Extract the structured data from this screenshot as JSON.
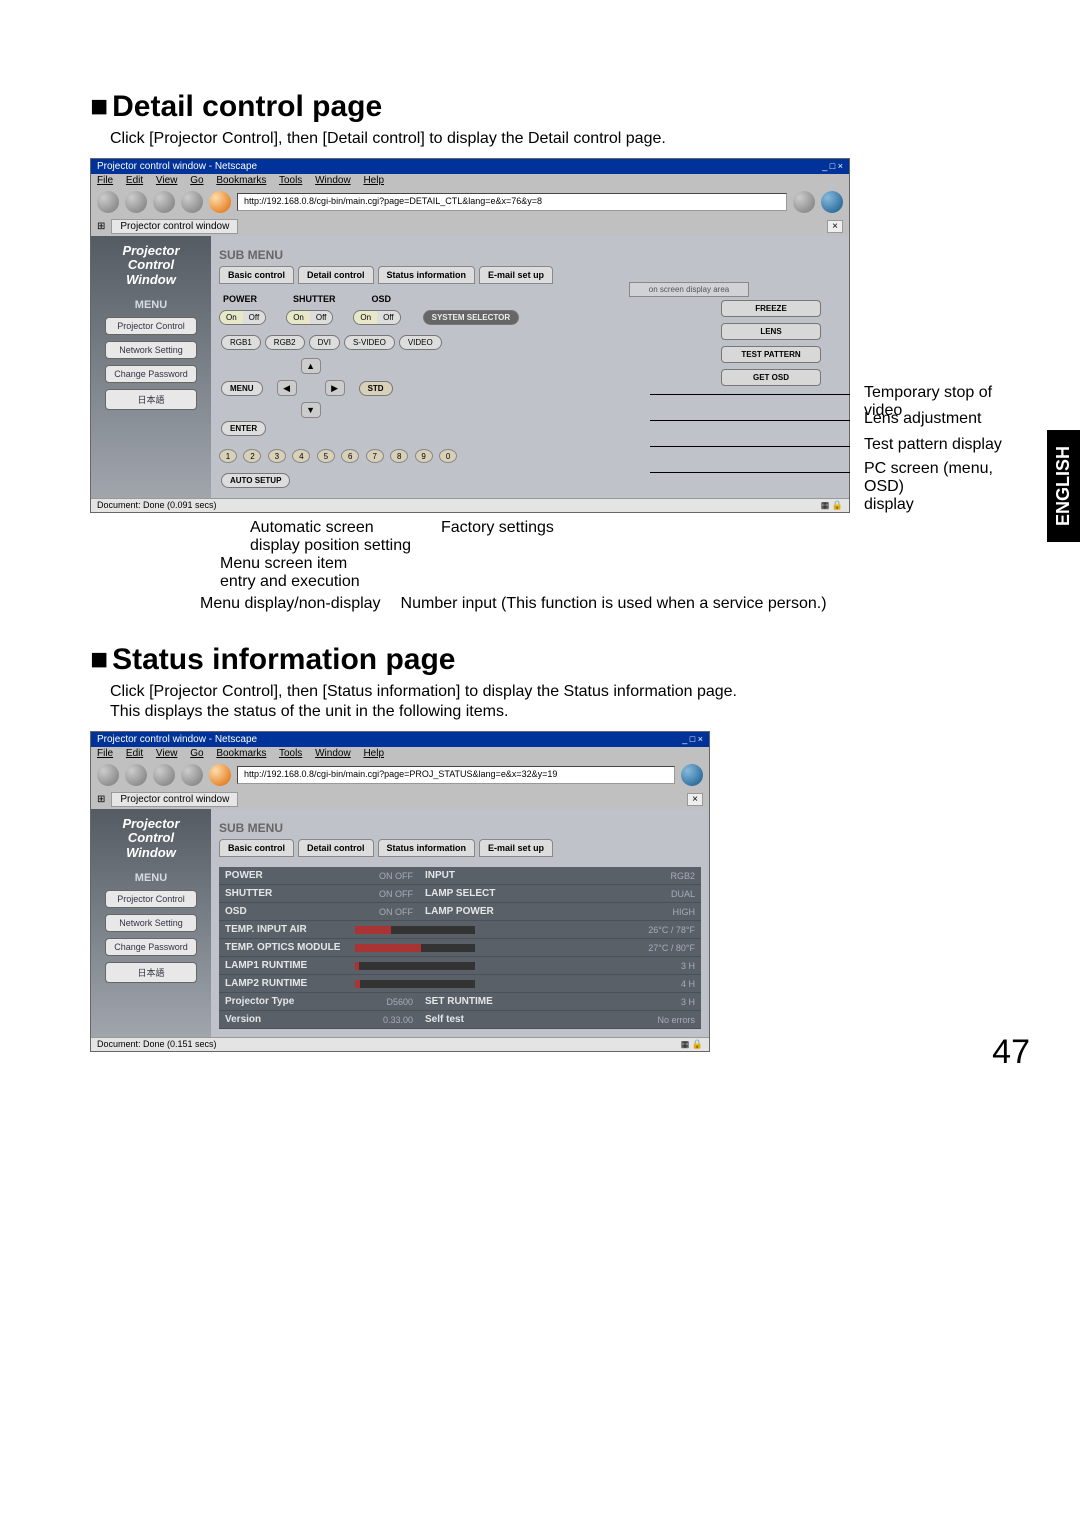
{
  "sideTab": "ENGLISH",
  "pageNumber": "47",
  "section1": {
    "heading": "Detail control page",
    "intro": "Click [Projector Control], then [Detail control] to display the Detail control page."
  },
  "section2": {
    "heading": "Status information page",
    "intro1": "Click [Projector Control], then [Status information] to display the Status information page.",
    "intro2": "This displays the status of the unit in the following items."
  },
  "browser1": {
    "title": "Projector control window - Netscape",
    "winControls": "_ □ ×",
    "menus": {
      "file": "File",
      "edit": "Edit",
      "view": "View",
      "go": "Go",
      "bookmarks": "Bookmarks",
      "tools": "Tools",
      "window": "Window",
      "help": "Help"
    },
    "url": "http://192.168.0.8/cgi-bin/main.cgi?page=DETAIL_CTL&lang=e&x=76&y=8",
    "tab": "Projector control window",
    "status": "Document: Done (0.091 secs)"
  },
  "browser2": {
    "title": "Projector control window - Netscape",
    "url": "http://192.168.0.8/cgi-bin/main.cgi?page=PROJ_STATUS&lang=e&x=32&y=19",
    "tab": "Projector control window",
    "status": "Document: Done (0.151 secs)"
  },
  "sidebar": {
    "pcw1": "Projector",
    "pcw2": "Control",
    "pcw3": "Window",
    "menu": "MENU",
    "items": {
      "projCtrl": "Projector Control",
      "netSet": "Network Setting",
      "chgPwd": "Change Password",
      "jp": "日本語"
    }
  },
  "submenu": {
    "label": "SUB MENU",
    "basic": "Basic control",
    "detail": "Detail control",
    "status": "Status information",
    "email": "E-mail set up"
  },
  "detail": {
    "hPower": "POWER",
    "hShutter": "SHUTTER",
    "hOsd": "OSD",
    "on": "On",
    "off": "Off",
    "sysSel": "SYSTEM SELECTOR",
    "rgb1": "RGB1",
    "rgb2": "RGB2",
    "dvi": "DVI",
    "svideo": "S-VIDEO",
    "video": "VIDEO",
    "menuBtn": "MENU",
    "stdBtn": "STD",
    "enterBtn": "ENTER",
    "autoSetup": "AUTO SETUP",
    "nums": [
      "1",
      "2",
      "3",
      "4",
      "5",
      "6",
      "7",
      "8",
      "9",
      "0"
    ],
    "freeze": "FREEZE",
    "lens": "LENS",
    "testPat": "TEST PATTERN",
    "getOsd": "GET OSD",
    "osdArea": "on screen display area"
  },
  "callouts": {
    "freeze": "Temporary stop of video",
    "lens": "Lens adjustment",
    "testpat": "Test pattern display",
    "getosd_l1": "PC screen (menu, OSD)",
    "getosd_l2": "display",
    "autoSetup_l1": "Automatic screen",
    "autoSetup_l2": "display position setting",
    "enter_l1": "Menu screen item",
    "enter_l2": "entry and execution",
    "menuBtn": "Menu display/non-display",
    "std": "Factory settings",
    "nums": "Number input (This function is used when a service person.)"
  },
  "status": {
    "rows": {
      "power": {
        "l": "POWER",
        "v1": "ON  OFF",
        "r": "INPUT",
        "v2": "RGB2"
      },
      "shutter": {
        "l": "SHUTTER",
        "v1": "ON  OFF",
        "r": "LAMP SELECT",
        "v2": "DUAL"
      },
      "osd": {
        "l": "OSD",
        "v1": "ON  OFF",
        "r": "LAMP POWER",
        "v2": "HIGH"
      },
      "tempAir": {
        "l": "TEMP. INPUT AIR",
        "v2": "26°C / 78°F"
      },
      "tempOpt": {
        "l": "TEMP. OPTICS MODULE",
        "v2": "27°C / 80°F"
      },
      "lamp1": {
        "l": "LAMP1 RUNTIME",
        "v2": "3 H"
      },
      "lamp2": {
        "l": "LAMP2 RUNTIME",
        "v2": "4 H"
      },
      "projType": {
        "l": "Projector Type",
        "v1": "D5600",
        "r": "SET RUNTIME",
        "v2": "3 H"
      },
      "version": {
        "l": "Version",
        "v1": "0.33.00",
        "r": "Self test",
        "v2": "No errors"
      }
    }
  }
}
